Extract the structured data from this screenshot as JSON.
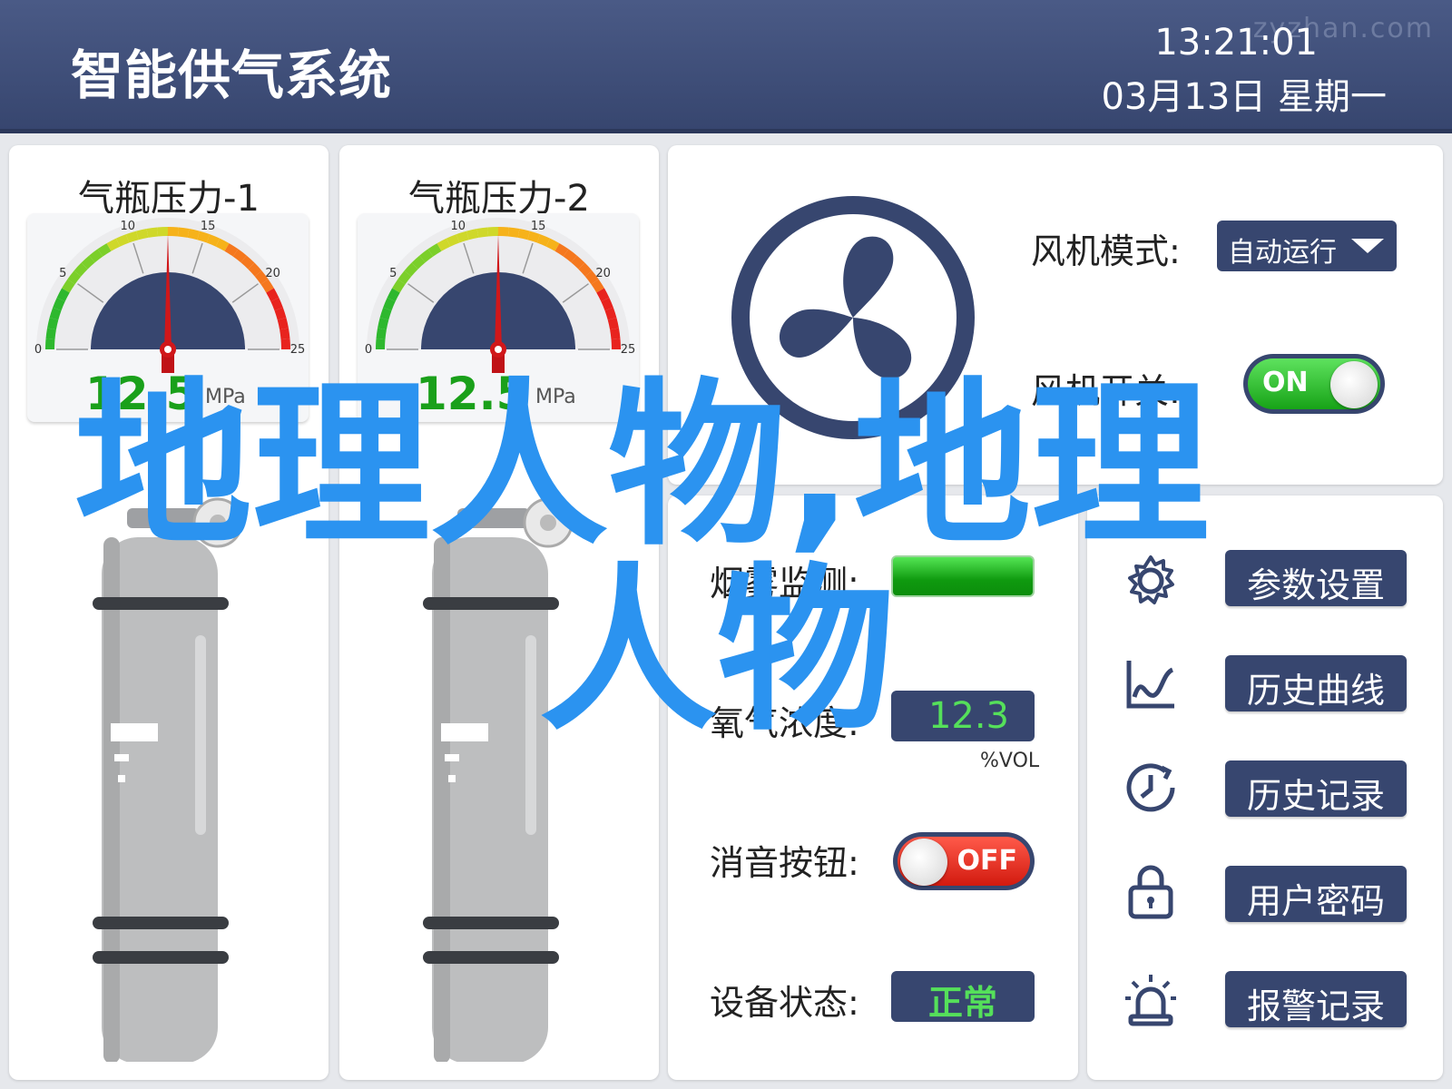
{
  "header": {
    "title": "智能供气系统",
    "time": "13:21:01",
    "date": "03月13日  星期一",
    "watermark": "zyzhan.com"
  },
  "gauges": [
    {
      "title": "气瓶压力-1",
      "value": "12.5",
      "unit": "MPa",
      "ticks": [
        "0",
        "5",
        "10",
        "15",
        "20",
        "25"
      ],
      "reading": 12.5,
      "max": 25
    },
    {
      "title": "气瓶压力-2",
      "value": "12.5",
      "unit": "MPa",
      "ticks": [
        "0",
        "5",
        "10",
        "15",
        "20",
        "25"
      ],
      "reading": 12.5,
      "max": 25
    }
  ],
  "fan": {
    "icon": "fan-icon",
    "mode_label": "风机模式:",
    "mode_value": "自动运行",
    "switch_label": "风机开关:",
    "switch_state": "ON"
  },
  "monitor": {
    "smoke_label": "烟雾监测:",
    "oxygen_label": "氧气浓度:",
    "oxygen_value": "12.3",
    "oxygen_unit": "%VOL",
    "mute_label": "消音按钮:",
    "mute_state": "OFF",
    "status_label": "设备状态:",
    "status_value": "正常"
  },
  "menu": [
    {
      "icon": "gear-icon",
      "label": "参数设置"
    },
    {
      "icon": "chart-icon",
      "label": "历史曲线"
    },
    {
      "icon": "clock-icon",
      "label": "历史记录"
    },
    {
      "icon": "lock-icon",
      "label": "用户密码"
    },
    {
      "icon": "alarm-icon",
      "label": "报警记录"
    }
  ],
  "overlay_text": {
    "line1": "地理人物,地理",
    "line2": "人物"
  },
  "colors": {
    "header": "#3f4e78",
    "panel_dark": "#37466f",
    "ok_green": "#55e05a",
    "overlay_blue": "#2b93f0"
  }
}
